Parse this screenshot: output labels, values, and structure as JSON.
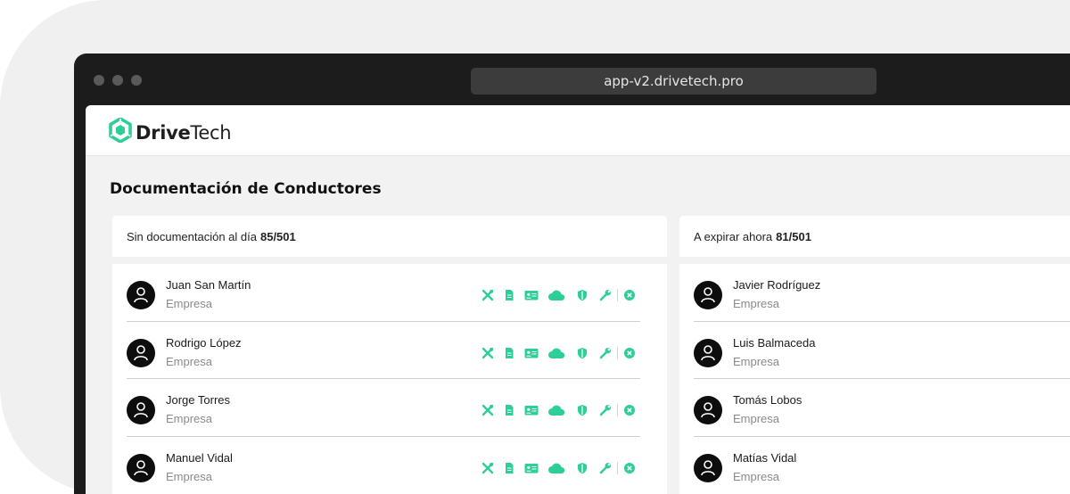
{
  "browser": {
    "url": "app-v2.drivetech.pro"
  },
  "brand": {
    "name_bold": "Drive",
    "name_light": "Tech",
    "accent": "#2ecf96"
  },
  "page": {
    "title": "Documentación de Conductores"
  },
  "panels": {
    "left": {
      "label": "Sin documentación al día",
      "count": "85/501",
      "rows": [
        {
          "name": "Juan San Martín",
          "company": "Empresa"
        },
        {
          "name": "Rodrigo López",
          "company": "Empresa"
        },
        {
          "name": "Jorge Torres",
          "company": "Empresa"
        },
        {
          "name": "Manuel Vidal",
          "company": "Empresa"
        }
      ]
    },
    "right": {
      "label": "A expirar ahora",
      "count": "81/501",
      "rows": [
        {
          "name": "Javier Rodríguez",
          "company": "Empresa"
        },
        {
          "name": "Luis Balmaceda",
          "company": "Empresa"
        },
        {
          "name": "Tomás Lobos",
          "company": "Empresa"
        },
        {
          "name": "Matías Vidal",
          "company": "Empresa"
        }
      ]
    }
  },
  "doc_icons": [
    "tools-icon",
    "document-icon",
    "id-card-icon",
    "cloud-icon",
    "shield-icon",
    "wrench-icon",
    "close-circle-icon"
  ]
}
